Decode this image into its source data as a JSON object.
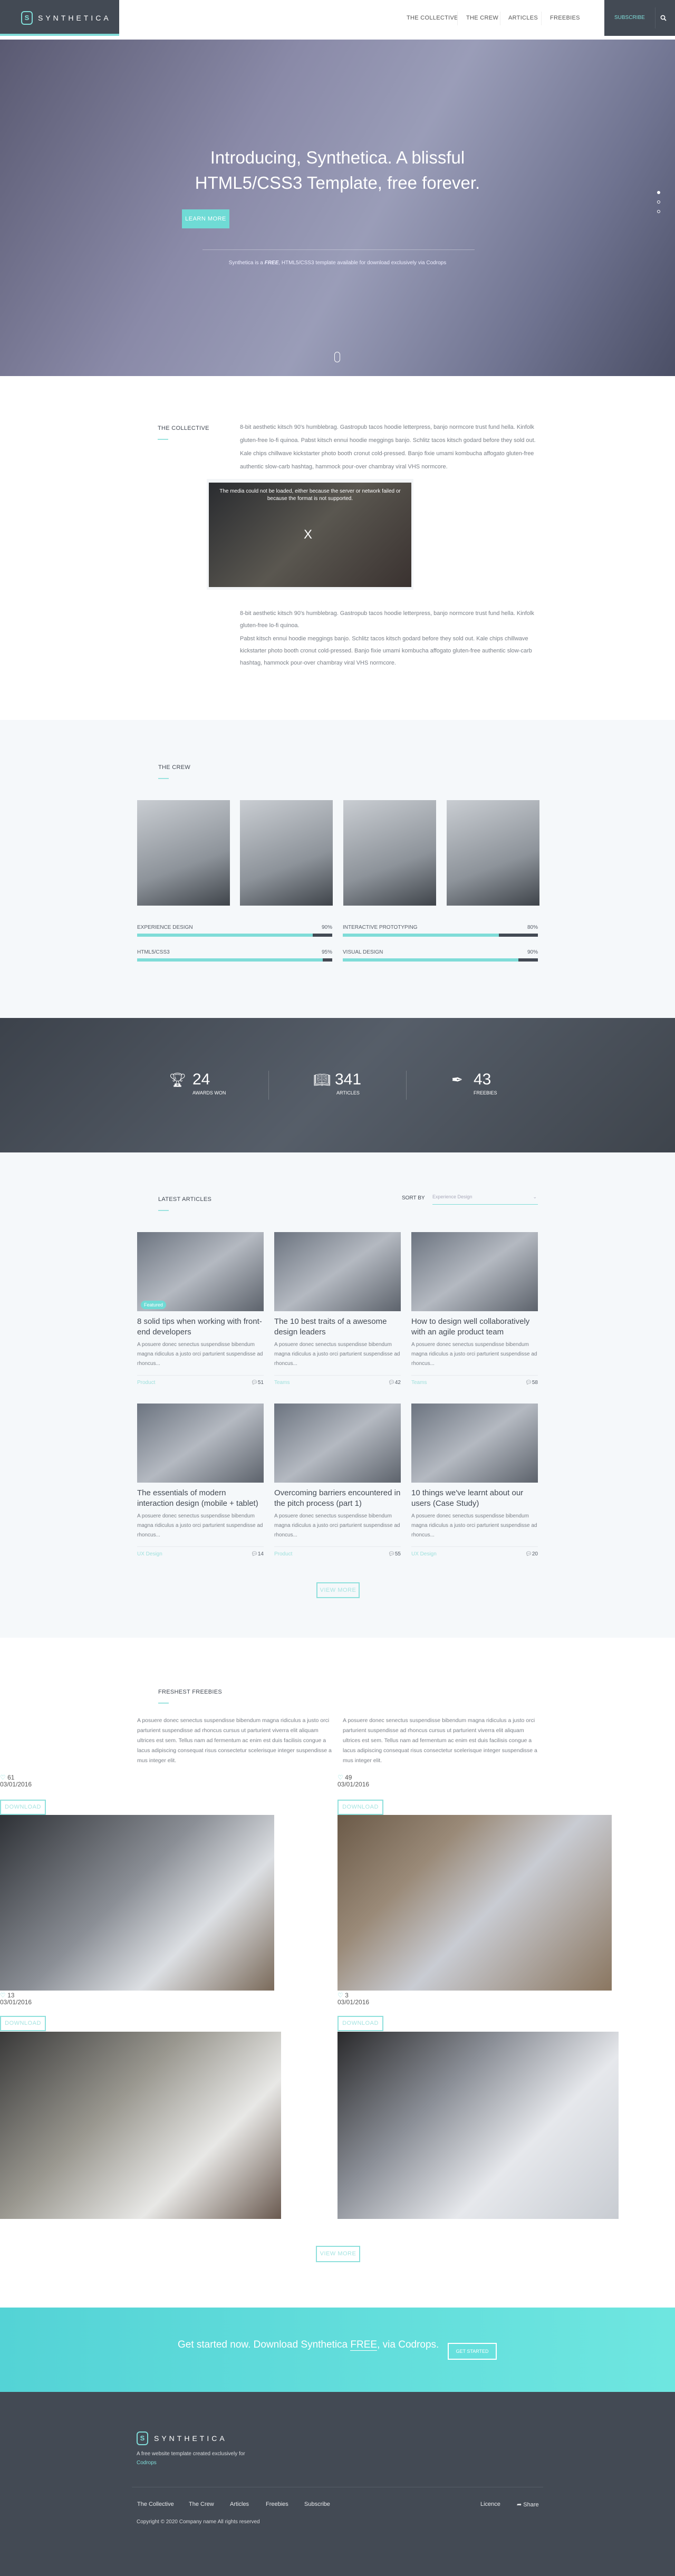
{
  "header": {
    "logo_text": "SYNTHETICA",
    "nav": [
      "THE COLLECTIVE",
      "THE CREW",
      "ARTICLES",
      "FREEBIES"
    ],
    "subscribe": "SUBSCRIBE"
  },
  "hero": {
    "title": "Introducing, Synthetica. A blissful HTML5/CSS3 Template, free forever.",
    "button": "LEARN MORE",
    "subtitle_pre": "Synthetica is a ",
    "subtitle_bold": "FREE",
    "subtitle_post": ", HTML5/CSS3 template available for download exclusively via Codrops"
  },
  "collective": {
    "title": "THE COLLECTIVE",
    "intro": "8-bit aesthetic kitsch 90's humblebrag. Gastropub tacos hoodie letterpress, banjo normcore trust fund hella. Kinfolk gluten-free lo-fi quinoa. Pabst kitsch ennui hoodie meggings banjo. Schlitz tacos kitsch godard before they sold out. Kale chips chillwave kickstarter photo booth cronut cold-pressed. Banjo fixie umami kombucha affogato gluten-free authentic slow-carb hashtag, hammock pour-over chambray viral VHS normcore.",
    "video_error": "The media could not be loaded, either because the server or network failed or because the format is not supported.",
    "video_x": "X",
    "p1": "8-bit aesthetic kitsch 90's humblebrag. Gastropub tacos hoodie letterpress, banjo normcore trust fund hella. Kinfolk gluten-free lo-fi quinoa.",
    "p2": "Pabst kitsch ennui hoodie meggings banjo. Schlitz tacos kitsch godard before they sold out. Kale chips chillwave kickstarter photo booth cronut cold-pressed. Banjo fixie umami kombucha affogato gluten-free authentic slow-carb hashtag, hammock pour-over chambray viral VHS normcore."
  },
  "crew": {
    "title": "THE CREW",
    "skills": [
      {
        "label": "EXPERIENCE DESIGN",
        "value": "90%",
        "pct": 90
      },
      {
        "label": "INTERACTIVE PROTOTYPING",
        "value": "80%",
        "pct": 80
      },
      {
        "label": "HTML5/CSS3",
        "value": "95%",
        "pct": 95
      },
      {
        "label": "VISUAL DESIGN",
        "value": "90%",
        "pct": 90
      }
    ]
  },
  "stats": [
    {
      "icon": "trophy-icon",
      "number": "24",
      "label": "AWARDS WON"
    },
    {
      "icon": "book-icon",
      "number": "341",
      "label": "ARTICLES"
    },
    {
      "icon": "pen-icon",
      "number": "43",
      "label": "FREEBIES"
    }
  ],
  "articles": {
    "title": "LATEST ARTICLES",
    "sort_label": "SORT BY",
    "sort_value": "Experience Design",
    "featured": "Featured",
    "excerpt": "A posuere donec senectus suspendisse bibendum magna ridiculus a justo orci parturient suspendisse ad rhoncus...",
    "items": [
      {
        "title": "8 solid tips when working with front-end developers",
        "category": "Product",
        "comments": "51"
      },
      {
        "title": "The 10 best traits of a awesome design leaders",
        "category": "Teams",
        "comments": "42"
      },
      {
        "title": "How to design well collaboratively with an agile product team",
        "category": "Teams",
        "comments": "58"
      },
      {
        "title": "The essentials of modern interaction design (mobile + tablet)",
        "category": "UX Design",
        "comments": "14"
      },
      {
        "title": "Overcoming barriers encountered in the pitch process (part 1)",
        "category": "Product",
        "comments": "55"
      },
      {
        "title": "10 things we've learnt about our users (Case Study)",
        "category": "UX Design",
        "comments": "20"
      }
    ],
    "view_more": "VIEW MORE"
  },
  "freebies": {
    "title": "FRESHEST FREEBIES",
    "text": "A posuere donec senectus suspendisse bibendum magna ridiculus a justo orci parturient suspendisse ad rhoncus cursus ut parturient viverra elit aliquam ultrices est sem. Tellus nam ad fermentum ac enim est duis facilisis congue a lacus adipiscing consequat risus consectetur scelerisque integer suspendisse a mus integer elit.",
    "items": [
      {
        "likes": "61",
        "date": "03/01/2016"
      },
      {
        "likes": "49",
        "date": "03/01/2016"
      },
      {
        "likes": "13",
        "date": "03/01/2016"
      },
      {
        "likes": "3",
        "date": "03/01/2016"
      }
    ],
    "download": "DOWNLOAD",
    "view_more": "VIEW MORE"
  },
  "cta": {
    "pre": "Get started now. Download Synthetica ",
    "bold": "FREE",
    "post": ", via Codrops.",
    "button": "GET STARTED"
  },
  "footer": {
    "logo_text": "SYNTHETICA",
    "tagline": "A free website template created exclusively for",
    "codrops": "Codrops",
    "links": [
      "The Collective",
      "The Crew",
      "Articles",
      "Freebies",
      "Subscribe"
    ],
    "licence": "Licence",
    "share": "Share",
    "copyright": "Copyright © 2020 Company name All rights reserved"
  },
  "colors": {
    "accent": "#7fdcd8",
    "dark": "#434a54",
    "light_bg": "#f5f8fa"
  }
}
